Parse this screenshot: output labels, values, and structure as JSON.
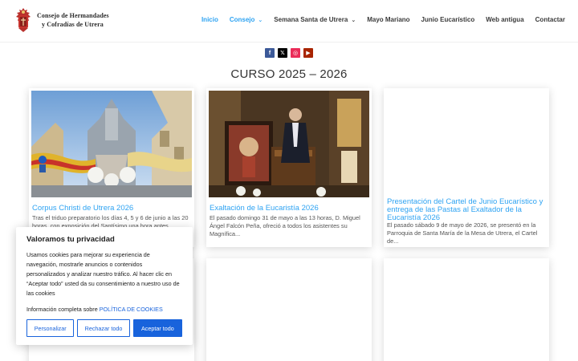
{
  "brand": {
    "line1": "Consejo de Hermandades",
    "line2": "y Cofradías de Utrera"
  },
  "nav": [
    {
      "label": "Inicio",
      "active": true,
      "dropdown": false
    },
    {
      "label": "Consejo",
      "active": true,
      "dropdown": true
    },
    {
      "label": "Semana Santa de Utrera",
      "active": false,
      "dropdown": true
    },
    {
      "label": "Mayo Mariano",
      "active": false,
      "dropdown": false
    },
    {
      "label": "Junio Eucarístico",
      "active": false,
      "dropdown": false
    },
    {
      "label": "Web antigua",
      "active": false,
      "dropdown": false
    },
    {
      "label": "Contactar",
      "active": false,
      "dropdown": false
    }
  ],
  "social": [
    {
      "icon": "facebook-icon",
      "glyph": "f"
    },
    {
      "icon": "x-icon",
      "glyph": "𝕏"
    },
    {
      "icon": "instagram-icon",
      "glyph": "◎"
    },
    {
      "icon": "youtube-icon",
      "glyph": "▶"
    }
  ],
  "page_title": "CURSO 2025 – 2026",
  "posts": [
    {
      "title": "Corpus Christi de Utrera 2026",
      "excerpt": "Tras el triduo preparatorio los días 4, 5 y 6 de junio a las 20 horas, con exposición del Santísimo una hora antes..."
    },
    {
      "title": "Exaltación de la Eucaristía 2026",
      "excerpt": "El pasado domingo 31 de mayo a las 13 horas, D. Miguel Ángel Falcón Peña, ofreció a todos los asistentes su Magnífica..."
    },
    {
      "title": "Presentación del Cartel de Junio Eucarístico y entrega de las Pastas al Exaltador de la Eucaristía 2026",
      "excerpt": "El pasado sábado 9 de mayo de 2026, se presentó en la Parroquia de Santa María de la Mesa de Utrera, el Cartel de..."
    }
  ],
  "cookie": {
    "title": "Valoramos tu privacidad",
    "text": "Usamos cookies para mejorar su experiencia de navegación, mostrarle anuncios o contenidos personalizados y analizar nuestro tráfico. Al hacer clic en “Aceptar todo” usted da su consentimiento a nuestro uso de las cookies",
    "info_prefix": "Información completa sobre ",
    "info_link": "POLÍTICA DE COOKIES",
    "btn_customize": "Personalizar",
    "btn_reject": "Rechazar todo",
    "btn_accept": "Aceptar todo"
  },
  "colors": {
    "accent": "#2ea3f2",
    "cookie_primary": "#1863dc"
  }
}
